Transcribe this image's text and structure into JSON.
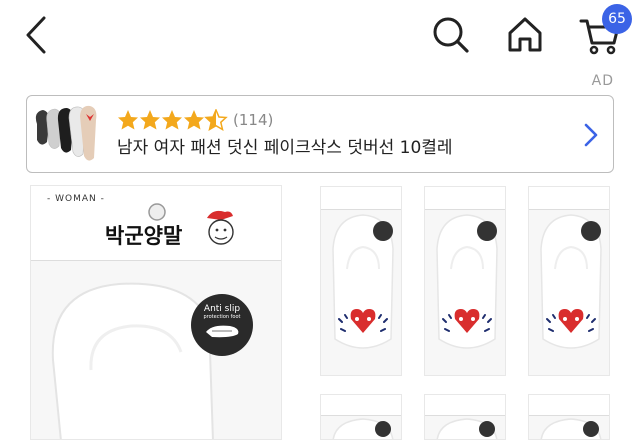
{
  "header": {
    "back_icon": "chevron-left-icon",
    "search_icon": "search-icon",
    "home_icon": "home-icon",
    "cart_icon": "cart-icon",
    "cart_count": "65"
  },
  "ad": {
    "ad_label": "AD",
    "rating": 4.5,
    "review_count": "(114)",
    "title": "남자 여자 패션 덧신 페이크삭스 덧버선 10켤레",
    "accent_color": "#3b63e6",
    "star_color": "#f3a81c"
  },
  "gallery": {
    "main_tag": "- WOMAN -",
    "brand": "박군양말",
    "anti_slip_line1": "Anti slip",
    "anti_slip_line2": "protection foot"
  }
}
